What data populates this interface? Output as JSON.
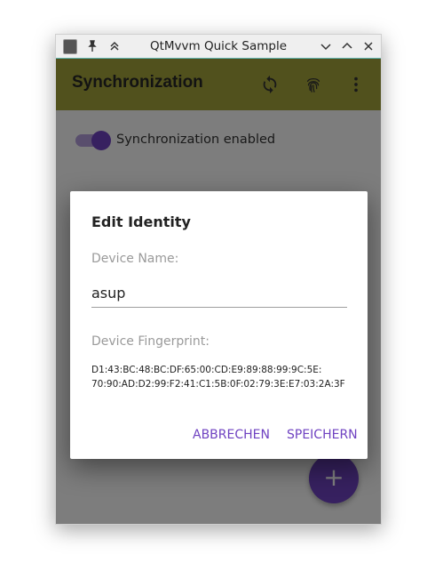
{
  "window": {
    "title": "QtMvvm Quick Sample"
  },
  "toolbar": {
    "title": "Synchronization"
  },
  "page": {
    "switch_label": "Synchronization enabled",
    "switch_on": true,
    "fab_label": "+"
  },
  "dialog": {
    "title": "Edit Identity",
    "device_name_label": "Device Name:",
    "device_name_value": "asup",
    "fingerprint_label": "Device Fingerprint:",
    "fingerprint_line1": "D1:43:BC:48:BC:DF:65:00:CD:E9:89:88:99:9C:5E:",
    "fingerprint_line2": "70:90:AD:D2:99:F2:41:C1:5B:0F:02:79:3E:E7:03:2A:3F",
    "cancel_label": "ABBRECHEN",
    "save_label": "SPEICHERN"
  },
  "colors": {
    "appbar": "#a3a33a",
    "accent": "#6f42c1"
  },
  "icons": [
    "app-icon",
    "pin-icon",
    "keep-above-icon",
    "minimize-icon",
    "maximize-icon",
    "close-icon",
    "sync-icon",
    "fingerprint-icon",
    "more-vert-icon",
    "plus-icon"
  ]
}
